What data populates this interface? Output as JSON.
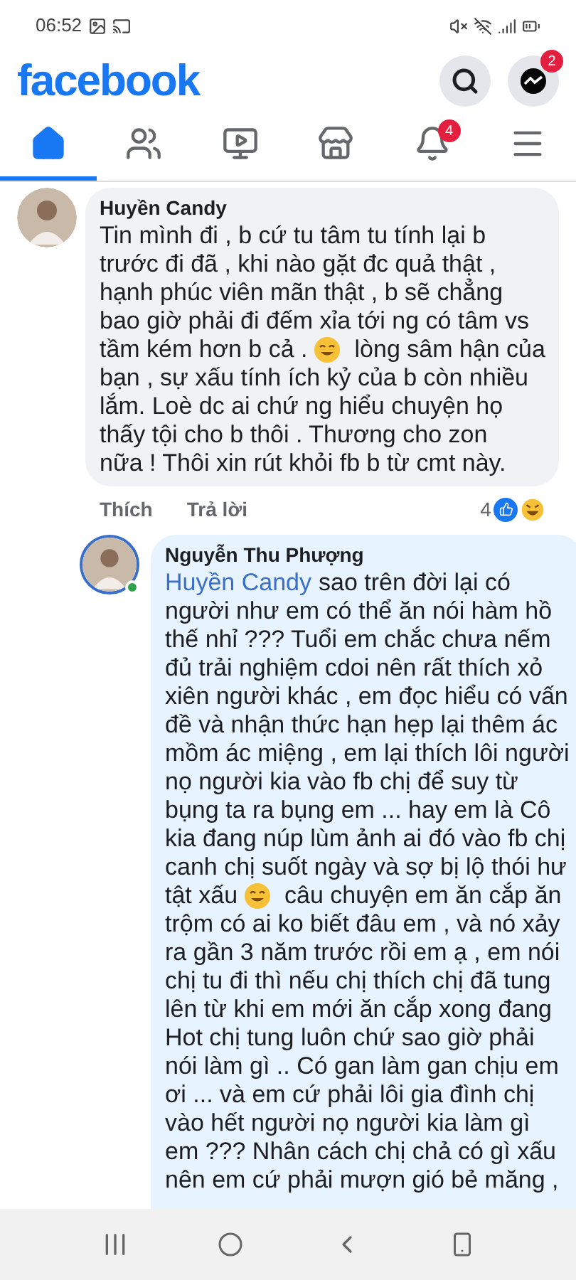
{
  "status_bar": {
    "time": "06:52"
  },
  "header": {
    "logo": "facebook",
    "messenger_badge": "2"
  },
  "nav_tabs": [
    {
      "kind": "home",
      "selected": true
    },
    {
      "kind": "groups",
      "selected": false
    },
    {
      "kind": "watch",
      "selected": false
    },
    {
      "kind": "marketplace",
      "selected": false
    },
    {
      "kind": "notifications",
      "selected": false,
      "badge": "4"
    },
    {
      "kind": "menu",
      "selected": false
    }
  ],
  "comments": [
    {
      "author": "Huyền Candy",
      "online": false,
      "lines": [
        [
          {
            "kind": "text",
            "text": "Tin mình đi ,  b cứ tu tâm tu tính lại b"
          }
        ],
        [
          {
            "kind": "text",
            "text": "trước đi đã , khi nào gặt đc quả thật ,"
          }
        ],
        [
          {
            "kind": "text",
            "text": "hạnh phúc viên mãn thật , b sẽ chẳng"
          }
        ],
        [
          {
            "kind": "text",
            "text": "bao giờ phải đi đếm xỉa tới ng có tâm vs"
          }
        ],
        [
          {
            "kind": "text",
            "text": "tầm kém hơn b cả ."
          },
          {
            "kind": "emoji"
          },
          {
            "kind": "text",
            "text": "lòng sâm hận của"
          }
        ],
        [
          {
            "kind": "text",
            "text": "bạn , sự xấu tính ích kỷ của b còn nhiều"
          }
        ],
        [
          {
            "kind": "text",
            "text": "lắm. Loè dc ai chứ ng hiểu chuyện họ"
          }
        ],
        [
          {
            "kind": "text",
            "text": "thấy tội cho b thôi . Thương cho zon"
          }
        ],
        [
          {
            "kind": "text",
            "text": "nữa ! Thôi xin rút khỏi fb b từ cmt này."
          }
        ]
      ],
      "actions": [
        "Thích",
        "Trả lời"
      ],
      "reaction_count": "4"
    },
    {
      "author": "Nguyễn Thu Phượng",
      "online": true,
      "lines": [
        [
          {
            "kind": "mention",
            "text": "Huyền Candy"
          },
          {
            "kind": "text",
            "text": "sao trên đời lại có"
          }
        ],
        [
          {
            "kind": "text",
            "text": "người như em có thể ăn nói hàm hồ"
          }
        ],
        [
          {
            "kind": "text",
            "text": "thế nhỉ ??? Tuổi em chắc chưa nếm"
          }
        ],
        [
          {
            "kind": "text",
            "text": "đủ trải nghiệm cdoi nên rất thích xỏ"
          }
        ],
        [
          {
            "kind": "text",
            "text": "xiên người khác , em đọc hiểu có vấn"
          }
        ],
        [
          {
            "kind": "text",
            "text": "đề và nhận thức hạn hẹp lại thêm ác"
          }
        ],
        [
          {
            "kind": "text",
            "text": "mồm ác miệng , em lại thích lôi người"
          }
        ],
        [
          {
            "kind": "text",
            "text": "nọ người kia vào fb chị để suy từ"
          }
        ],
        [
          {
            "kind": "text",
            "text": "bụng ta ra bụng em ... hay em là Cô"
          }
        ],
        [
          {
            "kind": "text",
            "text": "kia đang núp lùm ảnh ai đó vào fb chị"
          }
        ],
        [
          {
            "kind": "text",
            "text": "canh chị suốt ngày và sợ bị lộ thói hư"
          }
        ],
        [
          {
            "kind": "text",
            "text": "tật xấu"
          },
          {
            "kind": "emoji"
          },
          {
            "kind": "text",
            "text": "câu chuyện em ăn cắp ăn"
          }
        ],
        [
          {
            "kind": "text",
            "text": "trộm có ai ko biết đâu em , và nó xảy"
          }
        ],
        [
          {
            "kind": "text",
            "text": "ra gần 3 năm trước rồi em ạ , em nói"
          }
        ],
        [
          {
            "kind": "text",
            "text": "chị tu đi thì nếu chị thích chị đã tung"
          }
        ],
        [
          {
            "kind": "text",
            "text": "lên từ khi em mới ăn cắp xong đang"
          }
        ],
        [
          {
            "kind": "text",
            "text": "Hot chị tung luôn chứ sao giờ phải"
          }
        ],
        [
          {
            "kind": "text",
            "text": "nói làm gì .. Có gan làm gan chịu em"
          }
        ],
        [
          {
            "kind": "text",
            "text": "ơi ... và em cứ phải lôi gia đình chị"
          }
        ],
        [
          {
            "kind": "text",
            "text": "vào hết người nọ người kia làm gì"
          }
        ],
        [
          {
            "kind": "text",
            "text": "em ??? Nhân cách chị chả có gì xấu"
          }
        ],
        [
          {
            "kind": "text",
            "text": "nên em cứ phải mượn gió bẻ măng ,"
          }
        ]
      ]
    }
  ]
}
